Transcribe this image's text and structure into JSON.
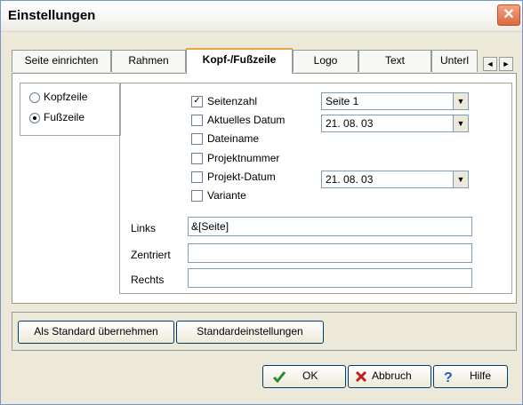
{
  "window": {
    "title": "Einstellungen",
    "close_glyph": "✕"
  },
  "tabs": [
    "Seite einrichten",
    "Rahmen",
    "Kopf-/Fußzeile",
    "Logo",
    "Text",
    "Unterl"
  ],
  "active_tab": "Kopf-/Fußzeile",
  "tab_scroll": {
    "left": "◄",
    "right": "►"
  },
  "position": {
    "options": [
      {
        "label": "Kopfzeile",
        "selected": false
      },
      {
        "label": "Fußzeile",
        "selected": true
      }
    ]
  },
  "fields": {
    "checkboxes": [
      {
        "label": "Seitenzahl",
        "checked": true
      },
      {
        "label": "Aktuelles Datum",
        "checked": false
      },
      {
        "label": "Dateiname",
        "checked": false
      },
      {
        "label": "Projektnummer",
        "checked": false
      },
      {
        "label": "Projekt-Datum",
        "checked": false
      },
      {
        "label": "Variante",
        "checked": false
      }
    ],
    "combos": {
      "seitenzahl": "Seite 1",
      "aktuelles_datum": "21. 08. 03",
      "projekt_datum": "21. 08. 03"
    },
    "text_fields": [
      {
        "label": "Links",
        "value": "&[Seite]"
      },
      {
        "label": "Zentriert",
        "value": ""
      },
      {
        "label": "Rechts",
        "value": ""
      }
    ]
  },
  "buttons": {
    "als_standard": "Als Standard übernehmen",
    "standardeinstellungen": "Standardeinstellungen",
    "ok": "OK",
    "abbruch": "Abbruch",
    "hilfe": "Hilfe"
  },
  "icons": {
    "ok": "checkmark-icon",
    "abbruch": "x-icon",
    "hilfe": "help-icon"
  },
  "colors": {
    "accent": "#e8a53c",
    "check": "#2b8a2b",
    "cross": "#c0201a",
    "help": "#1f5fbf"
  }
}
